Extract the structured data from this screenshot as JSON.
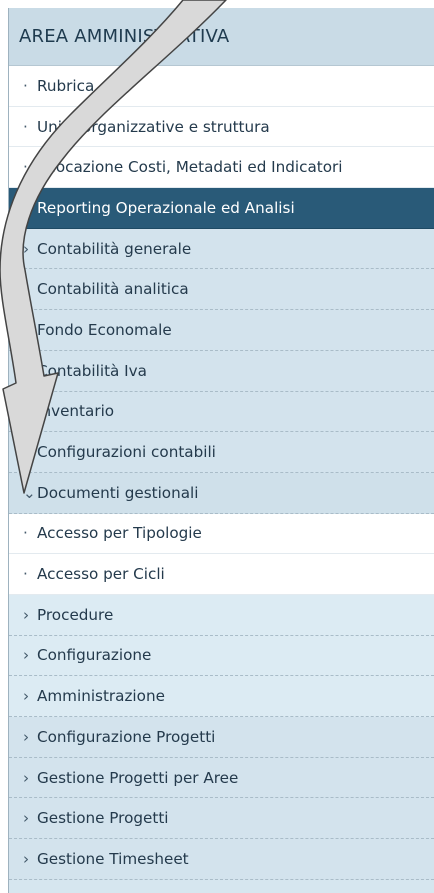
{
  "header": {
    "title": "AREA AMMINISTRATIVA"
  },
  "menu": [
    {
      "prefix": "·",
      "label": "Rubrica",
      "kind": "leaf"
    },
    {
      "prefix": "·",
      "label": "Unità organizzative e struttura",
      "kind": "leaf"
    },
    {
      "prefix": "·",
      "label": "Allocazione Costi, Metadati ed Indicatori",
      "kind": "leaf"
    },
    {
      "prefix": "·",
      "label": "Reporting Operazionale ed Analisi",
      "kind": "active"
    },
    {
      "prefix": "›",
      "label": "Contabilità generale",
      "kind": "group"
    },
    {
      "prefix": "›",
      "label": "Contabilità analitica",
      "kind": "group"
    },
    {
      "prefix": "›",
      "label": "Fondo Economale",
      "kind": "group"
    },
    {
      "prefix": "›",
      "label": "Contabilità Iva",
      "kind": "group"
    },
    {
      "prefix": "›",
      "label": "Inventario",
      "kind": "group"
    },
    {
      "prefix": "›",
      "label": "Configurazioni contabili",
      "kind": "group"
    },
    {
      "prefix": "⌄",
      "label": "Documenti gestionali",
      "kind": "expanded"
    },
    {
      "prefix": "·",
      "label": "Accesso per Tipologie",
      "kind": "leaf"
    },
    {
      "prefix": "·",
      "label": "Accesso per Cicli",
      "kind": "leaf"
    },
    {
      "prefix": "›",
      "label": "Procedure",
      "kind": "group-alt"
    },
    {
      "prefix": "›",
      "label": "Configurazione",
      "kind": "group-alt"
    },
    {
      "prefix": "›",
      "label": "Amministrazione",
      "kind": "group-alt"
    },
    {
      "prefix": "›",
      "label": "Configurazione Progetti",
      "kind": "group"
    },
    {
      "prefix": "›",
      "label": "Gestione Progetti per Aree",
      "kind": "group"
    },
    {
      "prefix": "›",
      "label": "Gestione Progetti",
      "kind": "group"
    },
    {
      "prefix": "›",
      "label": "Gestione Timesheet",
      "kind": "group"
    }
  ],
  "overlay": {
    "icon": "curved-arrow-icon",
    "fill_color": "#d9d9d9",
    "stroke_color": "#444444"
  }
}
